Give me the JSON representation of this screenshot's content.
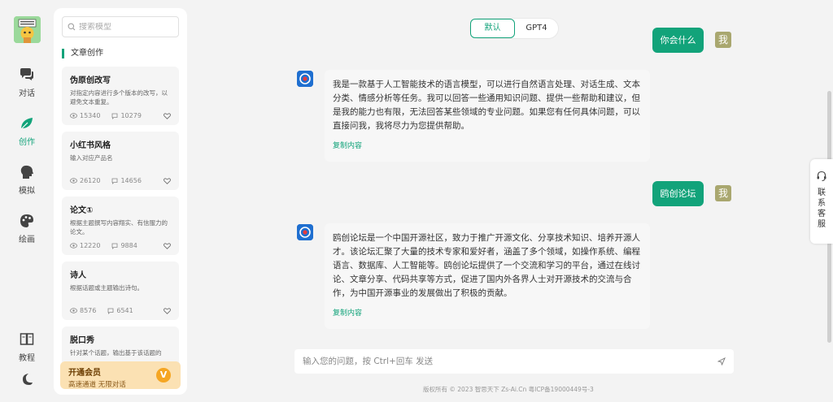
{
  "nav": {
    "items": [
      {
        "label": "对话",
        "icon": "chat-icon"
      },
      {
        "label": "创作",
        "icon": "leaf-icon",
        "active": true
      },
      {
        "label": "模拟",
        "icon": "head-icon"
      },
      {
        "label": "绘画",
        "icon": "palette-icon"
      }
    ],
    "tutorial": "教程",
    "theme_icon": "moon-icon"
  },
  "panel": {
    "search_placeholder": "搜索模型",
    "section_title": "文章创作",
    "cards": [
      {
        "title": "伪原创改写",
        "desc": "对指定内容进行多个版本的改写，以避免文本重复。",
        "views": "15340",
        "comments": "10279"
      },
      {
        "title": "小红书风格",
        "desc": "输入对应产品名",
        "views": "26120",
        "comments": "14656"
      },
      {
        "title": "论文①",
        "desc": "根据主题撰写内容翔实、有信服力的论文。",
        "views": "12220",
        "comments": "9884"
      },
      {
        "title": "诗人",
        "desc": "根据话题或主题输出诗句。",
        "views": "8576",
        "comments": "6541"
      },
      {
        "title": "脱口秀",
        "desc": "针对某个话题，输出基于该话题的",
        "views": "",
        "comments": ""
      }
    ],
    "vip": {
      "title": "开通会员",
      "subtitle": "高速通道 无限对话",
      "badge": "V"
    }
  },
  "toggle": {
    "options": [
      "默认",
      "GPT4"
    ]
  },
  "chat": {
    "user_avatar_text": "我",
    "copy_label": "复制内容",
    "messages": [
      {
        "role": "user",
        "text": "你会什么"
      },
      {
        "role": "bot",
        "text": "我是一款基于人工智能技术的语言模型，可以进行自然语言处理、对话生成、文本分类、情感分析等任务。我可以回答一些通用知识问题、提供一些帮助和建议，但是我的能力也有限，无法回答某些领域的专业问题。如果您有任何具体问题，可以直接问我，我将尽力为您提供帮助。"
      },
      {
        "role": "user",
        "text": "鸥创论坛"
      },
      {
        "role": "bot",
        "text": "鸥创论坛是一个中国开源社区，致力于推广开源文化、分享技术知识、培养开源人才。该论坛汇聚了大量的技术专家和爱好者，涵盖了多个领域，如操作系统、编程语言、数据库、人工智能等。鸥创论坛提供了一个交流和学习的平台，通过在线讨论、文章分享、代码共享等方式，促进了国内外各界人士对开源技术的交流与合作，为中国开源事业的发展做出了积极的贡献。"
      }
    ],
    "input_placeholder": "输入您的问题，按 Ctrl+回车 发送"
  },
  "footer": "版权所有 © 2023 智思天下 Zs-Ai.Cn    粤ICP备19000449号-3",
  "contact": {
    "label": "联系客服"
  },
  "colors": {
    "accent": "#12a37a",
    "vip_bg": "#fbe1b3"
  }
}
